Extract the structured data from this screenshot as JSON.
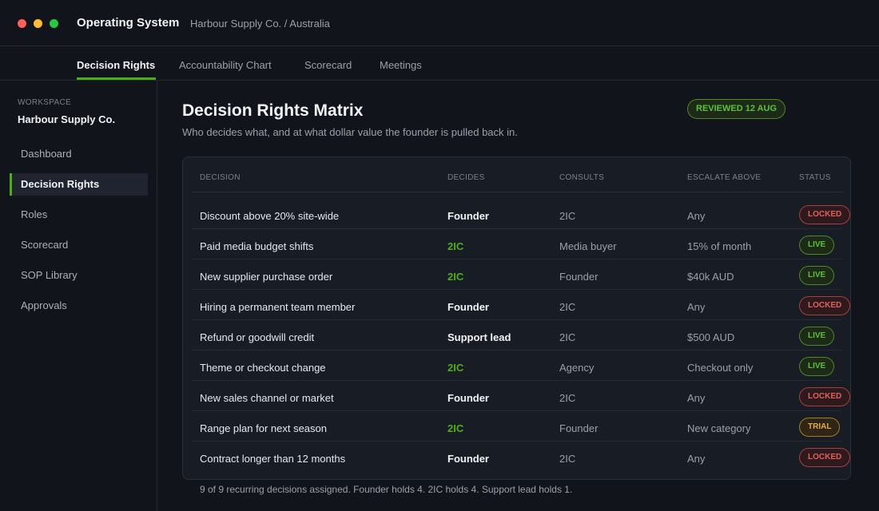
{
  "window": {
    "title": "Operating System",
    "breadcrumb": "Harbour Supply Co. / Australia"
  },
  "tabs": [
    {
      "label": "Decision Rights",
      "active": true
    },
    {
      "label": "Accountability Chart"
    },
    {
      "label": "Scorecard"
    },
    {
      "label": "Meetings"
    }
  ],
  "sidebar": {
    "workspace_label": "WORKSPACE",
    "workspace_name": "Harbour Supply Co.",
    "items": [
      {
        "label": "Dashboard"
      },
      {
        "label": "Decision Rights",
        "active": true
      },
      {
        "label": "Roles"
      },
      {
        "label": "Scorecard"
      },
      {
        "label": "SOP Library"
      },
      {
        "label": "Approvals"
      }
    ]
  },
  "main": {
    "title": "Decision Rights Matrix",
    "subtitle": "Who decides what, and at what dollar value the founder is pulled back in.",
    "review_badge": "REVIEWED 12 AUG",
    "table": {
      "columns": [
        "DECISION",
        "DECIDES",
        "CONSULTS",
        "ESCALATE ABOVE",
        "STATUS"
      ],
      "rows": [
        {
          "decision": "Discount above 20% site-wide",
          "decides": "Founder",
          "consults": "2IC",
          "escalate": "Any",
          "status": "LOCKED"
        },
        {
          "decision": "Paid media budget shifts",
          "decides": "2IC",
          "consults": "Media buyer",
          "escalate": "15% of month",
          "status": "LIVE"
        },
        {
          "decision": "New supplier purchase order",
          "decides": "2IC",
          "consults": "Founder",
          "escalate": "$40k AUD",
          "status": "LIVE"
        },
        {
          "decision": "Hiring a permanent team member",
          "decides": "Founder",
          "consults": "2IC",
          "escalate": "Any",
          "status": "LOCKED"
        },
        {
          "decision": "Refund or goodwill credit",
          "decides": "Support lead",
          "consults": "2IC",
          "escalate": "$500 AUD",
          "status": "LIVE"
        },
        {
          "decision": "Theme or checkout change",
          "decides": "2IC",
          "consults": "Agency",
          "escalate": "Checkout only",
          "status": "LIVE"
        },
        {
          "decision": "New sales channel or market",
          "decides": "Founder",
          "consults": "2IC",
          "escalate": "Any",
          "status": "LOCKED"
        },
        {
          "decision": "Range plan for next season",
          "decides": "2IC",
          "consults": "Founder",
          "escalate": "New category",
          "status": "TRIAL"
        },
        {
          "decision": "Contract longer than 12 months",
          "decides": "Founder",
          "consults": "2IC",
          "escalate": "Any",
          "status": "LOCKED"
        }
      ]
    },
    "footnote": "9 of 9 recurring decisions assigned. Founder holds 4. 2IC holds 4. Support lead holds 1."
  },
  "colors": {
    "accent_green": "#4caf1a",
    "status_locked": "#e0605c",
    "status_live": "#5cc234",
    "status_trial": "#e0ad3c"
  }
}
